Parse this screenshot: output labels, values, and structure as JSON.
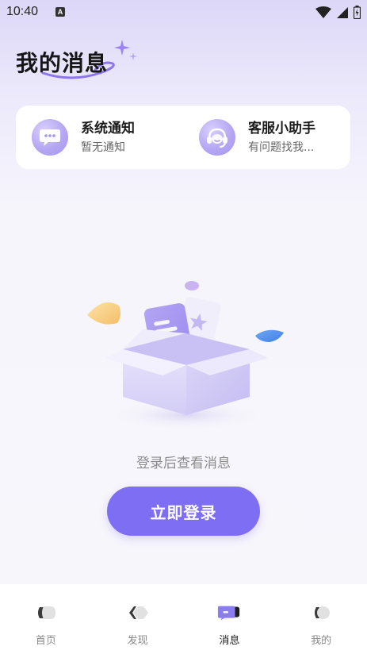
{
  "status_bar": {
    "time": "10:40",
    "notification_badge": "A",
    "icons": [
      "wifi-icon",
      "cellular-signal-icon",
      "battery-icon"
    ]
  },
  "page": {
    "title": "我的消息"
  },
  "messages": [
    {
      "title": "系统通知",
      "subtitle": "暂无通知",
      "icon": "chat-bubble-icon"
    },
    {
      "title": "客服小助手",
      "subtitle": "有问题找我...",
      "icon": "headset-icon"
    }
  ],
  "empty_state": {
    "text": "登录后查看消息",
    "button_label": "立即登录"
  },
  "bottom_nav": {
    "active_index": 2,
    "items": [
      {
        "label": "首页",
        "icon": "home-icon"
      },
      {
        "label": "发现",
        "icon": "discover-icon"
      },
      {
        "label": "消息",
        "icon": "message-icon"
      },
      {
        "label": "我的",
        "icon": "profile-icon"
      }
    ]
  },
  "colors": {
    "accent": "#7d6ef3",
    "icon_circle": "#b6a7f3",
    "background_top": "#dcd7f7",
    "card": "#ffffff"
  }
}
